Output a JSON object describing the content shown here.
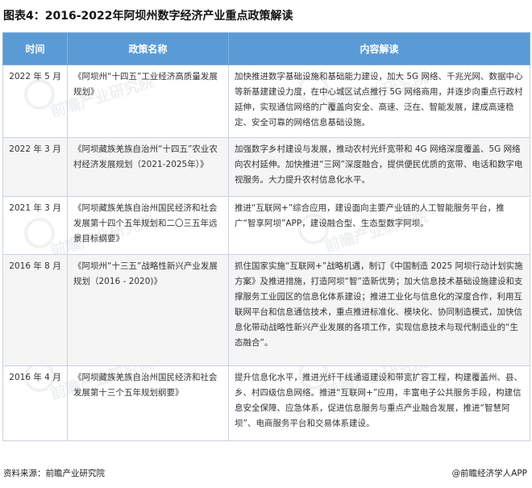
{
  "title": "图表4：2016-2022年阿坝州数字经济产业重点政策解读",
  "headers": {
    "time": "时间",
    "policy": "政策名称",
    "content": "内容解读"
  },
  "rows": [
    {
      "time": "2022 年 5 月",
      "policy": "《阿坝州“十四五”工业经济高质量发展规划》",
      "content": "加快推进数字基础设施和基础能力建设，加大 5G 网络、千兆光网、数据中心等新基建建设力度，在中心城区试点推行 5G 网络商用，并逐步向重点行政村延伸，实现通信网络的广覆盖向安全、高速、泛在、智能发展，建成高速稳定、安全可靠的网络信息基础设施。"
    },
    {
      "time": "2022 年 3 月",
      "policy": "《阿坝藏族羌族自治州“十四五”农业农村经济发展规划（2021-2025年）》",
      "content": "加强数字乡村建设与发展，推动农村光纤宽带和 4G 网络深度覆盖、5G 网络向农村延伸。加快推进“三网”深度融合，提供便民优质的宽带、电话和数字电视服务。大力提升农村信息化水平。"
    },
    {
      "time": "2021 年 3 月",
      "policy": "《阿坝藏族羌族自治州国民经济和社会发展第十四个五年规划和二〇三五年远景目标纲要》",
      "content": "推进“互联网+”综合应用，建设面向主要产业链的人工智能服务平台，推广“智享阿坝”APP，建设融合型、生态型数字阿坝。"
    },
    {
      "time": "2016 年 8 月",
      "policy": "《阿坝州“十三五”战略性新兴产业发展规划（2016 - 2020)》",
      "content": "抓住国家实施“互联网+”战略机遇，制订《中国制造 2025 阿坝行动计划实施方案》及推进措施，打造阿坝“智”造新优势；加大信息技术基础设施建设和支撑服务工业园区的信息化体系建设；推进工业化与信息化的深度合作，利用互联网平台和信息通信技术，重点推进标准化、模块化、协同制造模式，加快信息化带动战略性新兴产业发展的各项工作，实现信息技术与现代制造业的“生态融合”。"
    },
    {
      "time": "2016 年 4 月",
      "policy": "《阿坝藏族羌族自治州国民经济和社会发展第十三个五年规划纲要》",
      "content": "提升信息化水平，推进光纤干线通道建设和带宽扩容工程，构建覆盖州、县、乡、村四级信息网络。推进“互联网+”应用，丰富电子公共服务手段，构建信息安全保障、应急体系，促进信息服务与重点产业融合发展，推进“智慧阿坝”、电商服务平台和交易体系建设。"
    }
  ],
  "watermark": "前瞻产业研究院",
  "footer": {
    "source": "资料来源：前瞻产业研究院",
    "brand": "@前瞻经济学人APP"
  }
}
